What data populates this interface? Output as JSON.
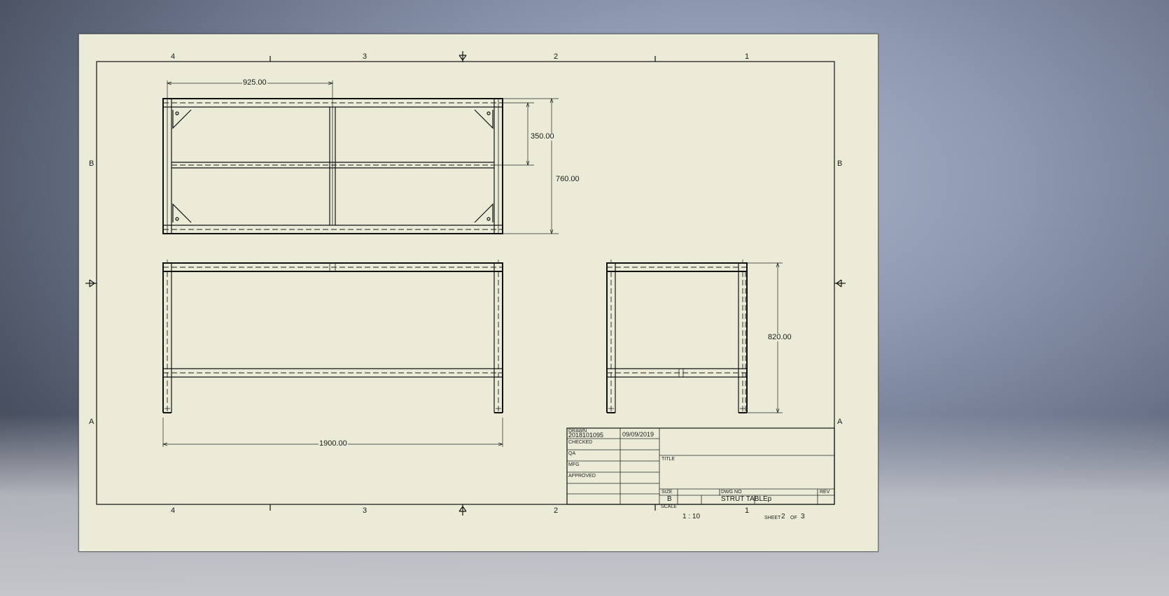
{
  "zones": {
    "columns": [
      "4",
      "3",
      "2",
      "1"
    ],
    "rows": [
      "B",
      "A"
    ]
  },
  "dimensions": {
    "half_length": "925.00",
    "shelf_spacing": "350.00",
    "depth": "760.00",
    "height": "820.00",
    "length": "1900.00"
  },
  "title_block": {
    "drawn_label": "DRAWN",
    "drawn_by": "2018101095",
    "drawn_date": "09/09/2019",
    "checked_label": "CHECKED",
    "qa_label": "QA",
    "mfg_label": "MFG",
    "approved_label": "APPROVED",
    "title_label": "TITLE",
    "size_label": "SIZE",
    "size_value": "B",
    "dwg_no_label": "DWG NO",
    "dwg_no_value": "STRUT TABLEp",
    "rev_label": "REV",
    "scale_label": "SCALE",
    "scale_value": "1 : 10",
    "sheet_label": "SHEET",
    "sheet_number": "2",
    "of_label": "OF",
    "sheet_total": "3"
  }
}
